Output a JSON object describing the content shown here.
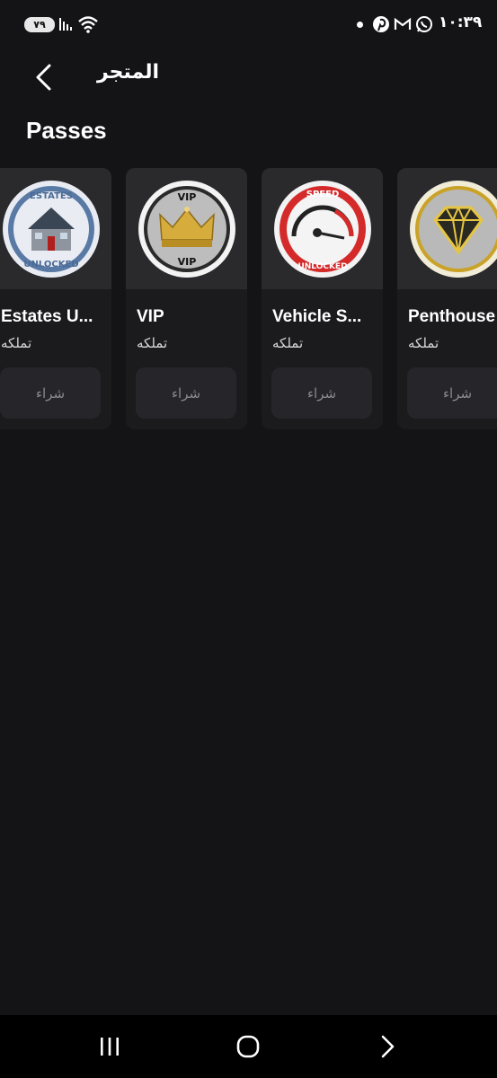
{
  "status_bar": {
    "battery": "٧٩",
    "time": "١٠:٣٩",
    "icons": [
      "signal-icon",
      "wifi-icon",
      "notification-dot-icon",
      "pinterest-icon",
      "gmail-icon",
      "whatsapp-icon"
    ]
  },
  "header": {
    "title": "المتجر",
    "back_icon": "chevron-left-icon"
  },
  "section": {
    "title": "Passes"
  },
  "passes": [
    {
      "name": "Estates U...",
      "status": "تملكه",
      "button": "شراء",
      "image_text_top": "ESTATES",
      "image_text_bottom": "UNLOCKED",
      "icon": "house-icon"
    },
    {
      "name": "VIP",
      "status": "تملكه",
      "button": "شراء",
      "image_text_top": "VIP",
      "image_text_bottom": "VIP",
      "icon": "crown-icon"
    },
    {
      "name": "Vehicle S...",
      "status": "تملكه",
      "button": "شراء",
      "image_text_top": "SPEED",
      "image_text_bottom": "UNLOCKED",
      "icon": "speedometer-icon"
    },
    {
      "name": "Penthouse",
      "status": "تملكه",
      "button": "شراء",
      "icon": "diamond-icon"
    }
  ],
  "colors": {
    "background": "#141416",
    "card": "#1b1b1e",
    "button": "#26262a",
    "gold": "#c9a227",
    "red": "#d42a2a"
  }
}
